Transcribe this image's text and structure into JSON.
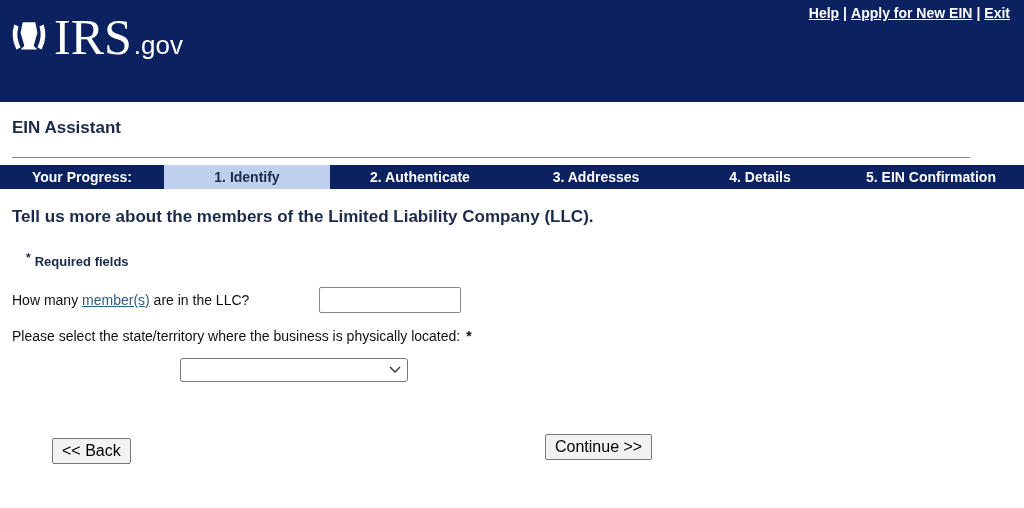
{
  "header": {
    "logo_text": "IRS",
    "logo_suffix": ".gov",
    "links": [
      {
        "label": "Help"
      },
      {
        "label": "Apply for New EIN"
      },
      {
        "label": "Exit"
      }
    ],
    "separator": "|"
  },
  "app_title": "EIN Assistant",
  "progress": {
    "label": "Your Progress:",
    "steps": [
      {
        "label": "1. Identify",
        "selected": true
      },
      {
        "label": "2. Authenticate",
        "selected": false
      },
      {
        "label": "3. Addresses",
        "selected": false
      },
      {
        "label": "4. Details",
        "selected": false
      },
      {
        "label": "5. EIN Confirmation",
        "selected": false
      }
    ]
  },
  "heading": "Tell us more about the members of the Limited Liability Company (LLC).",
  "required_note": {
    "mark": "*",
    "text": "Required fields"
  },
  "members_question": {
    "before": "How many",
    "link": "member(s)",
    "after": "are in the LLC?"
  },
  "state_question": {
    "text": "Please select the state/territory where the business is physically located:",
    "mark": "*"
  },
  "buttons": {
    "back": "<< Back",
    "continue": "Continue >>"
  }
}
